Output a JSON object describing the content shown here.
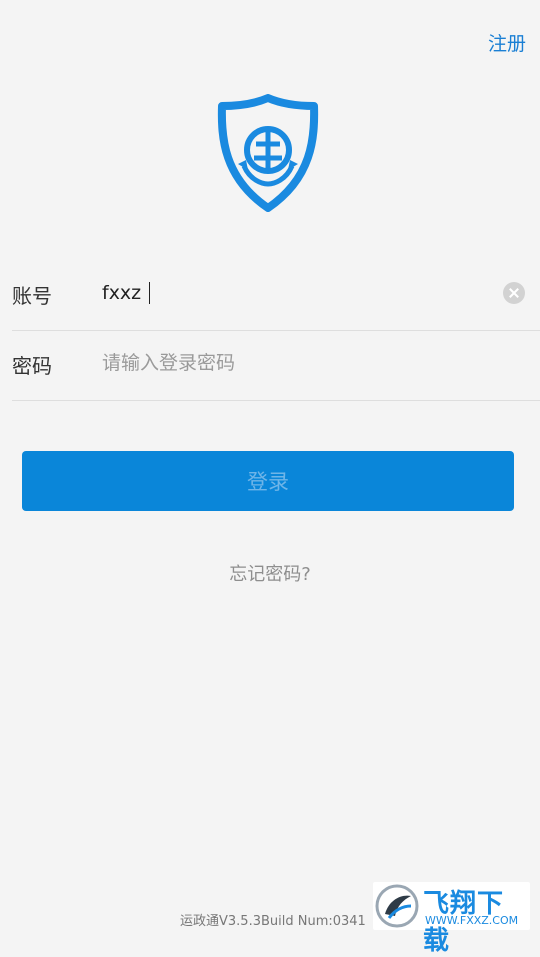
{
  "header": {
    "register_label": "注册"
  },
  "logo": {
    "icon": "shield-anchor-logo",
    "color": "#1a8ae0"
  },
  "form": {
    "account": {
      "label": "账号",
      "value": "fxxz"
    },
    "password": {
      "label": "密码",
      "placeholder": "请输入登录密码"
    }
  },
  "actions": {
    "login_label": "登录",
    "forgot_label": "忘记密码?"
  },
  "footer": {
    "version": "运政通V3.5.3Build Num:0341"
  },
  "watermark": {
    "title": "飞翔下载",
    "url": "WWW.FXXZ.COM"
  },
  "colors": {
    "accent": "#0a86d9",
    "background": "#f4f4f4"
  }
}
